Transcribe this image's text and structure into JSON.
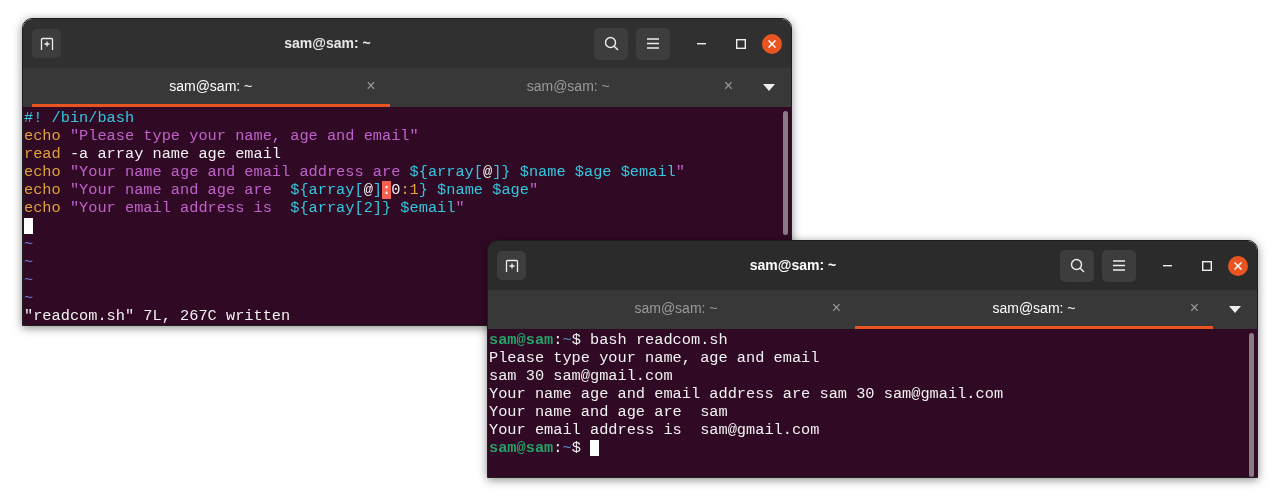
{
  "windows": [
    {
      "title": "sam@sam: ~",
      "focused": false,
      "tabs": [
        {
          "label": "sam@sam: ~",
          "close": "×",
          "selected": true
        },
        {
          "label": "sam@sam: ~",
          "close": "×",
          "selected": false
        }
      ],
      "lines": [
        {
          "segments": [
            {
              "text": "#! /bin/bash",
              "kind": "comment"
            }
          ]
        },
        {
          "segments": [
            {
              "text": "echo",
              "kind": "keyword"
            },
            {
              "text": " \"Please type your name, age and email\"",
              "kind": "string"
            }
          ]
        },
        {
          "segments": [
            {
              "text": "read",
              "kind": "keyword"
            },
            {
              "text": " -a array name age email",
              "kind": "plain"
            }
          ]
        },
        {
          "segments": [
            {
              "text": "echo",
              "kind": "keyword"
            },
            {
              "text": " \"Your name age and email address are ",
              "kind": "string"
            },
            {
              "text": "${array[",
              "kind": "variable"
            },
            {
              "text": "@",
              "kind": "plain"
            },
            {
              "text": "]} $name $age $email",
              "kind": "variable"
            },
            {
              "text": "\"",
              "kind": "string"
            }
          ]
        },
        {
          "segments": [
            {
              "text": "echo",
              "kind": "keyword"
            },
            {
              "text": " \"Your name and age are  ",
              "kind": "string"
            },
            {
              "text": "${array[",
              "kind": "variable"
            },
            {
              "text": "@",
              "kind": "plain"
            },
            {
              "text": "]",
              "kind": "variable"
            },
            {
              "text": ":",
              "kind": "error"
            },
            {
              "text": "0",
              "kind": "plain"
            },
            {
              "text": ":1",
              "kind": "keyword"
            },
            {
              "text": "} $name $age",
              "kind": "variable"
            },
            {
              "text": "\"",
              "kind": "string"
            }
          ]
        },
        {
          "segments": [
            {
              "text": "echo",
              "kind": "keyword"
            },
            {
              "text": " \"Your email address is  ",
              "kind": "string"
            },
            {
              "text": "${array[2]} $email",
              "kind": "variable"
            },
            {
              "text": "\"",
              "kind": "string"
            }
          ]
        },
        {
          "cursor": true
        },
        {
          "segments": [
            {
              "text": "~",
              "kind": "tilde"
            }
          ]
        },
        {
          "segments": [
            {
              "text": "~",
              "kind": "tilde"
            }
          ]
        },
        {
          "segments": [
            {
              "text": "~",
              "kind": "tilde"
            }
          ]
        },
        {
          "segments": [
            {
              "text": "~",
              "kind": "tilde"
            }
          ]
        },
        {
          "segments": [
            {
              "text": "\"readcom.sh\" 7L, 267C written",
              "kind": "plain"
            }
          ]
        }
      ]
    },
    {
      "title": "sam@sam: ~",
      "focused": true,
      "tabs": [
        {
          "label": "sam@sam: ~",
          "close": "×",
          "selected": false
        },
        {
          "label": "sam@sam: ~",
          "close": "×",
          "selected": true
        }
      ],
      "lines": [
        {
          "segments": [
            {
              "text": "sam@sam",
              "kind": "prompt"
            },
            {
              "text": ":",
              "kind": "plain"
            },
            {
              "text": "~",
              "kind": "path"
            },
            {
              "text": "$ bash readcom.sh",
              "kind": "plain"
            }
          ]
        },
        {
          "segments": [
            {
              "text": "Please type your name, age and email",
              "kind": "plain"
            }
          ]
        },
        {
          "segments": [
            {
              "text": "sam 30 sam@gmail.com",
              "kind": "plain"
            }
          ]
        },
        {
          "segments": [
            {
              "text": "Your name age and email address are sam 30 sam@gmail.com",
              "kind": "plain"
            }
          ]
        },
        {
          "segments": [
            {
              "text": "Your name and age are  sam",
              "kind": "plain"
            }
          ]
        },
        {
          "segments": [
            {
              "text": "Your email address is  sam@gmail.com",
              "kind": "plain"
            }
          ]
        },
        {
          "segments": [
            {
              "text": "sam@sam",
              "kind": "prompt"
            },
            {
              "text": ":",
              "kind": "plain"
            },
            {
              "text": "~",
              "kind": "path"
            },
            {
              "text": "$ ",
              "kind": "plain"
            }
          ],
          "cursor": true
        }
      ]
    }
  ]
}
